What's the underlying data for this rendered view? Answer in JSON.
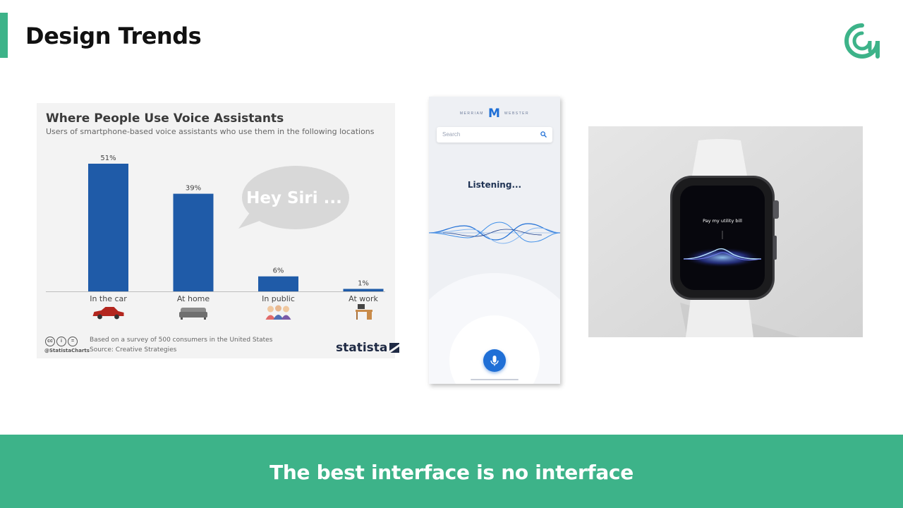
{
  "slide": {
    "title": "Design Trends",
    "tagline": "The best interface is no interface",
    "accent_color": "#3db389"
  },
  "chart_data": {
    "type": "bar",
    "title": "Where People Use Voice Assistants",
    "subtitle": "Users of smartphone-based voice assistants who use them in the following locations",
    "categories": [
      "In the car",
      "At home",
      "In public",
      "At work"
    ],
    "values": [
      51,
      39,
      6,
      1
    ],
    "value_labels": [
      "51%",
      "39%",
      "6%",
      "1%"
    ],
    "category_icons": [
      "car-icon",
      "sofa-icon",
      "people-icon",
      "desk-icon"
    ],
    "ylim": [
      0,
      51
    ],
    "bar_color": "#1f5ba8",
    "grid": false,
    "annotation": "Hey Siri ...",
    "footnote": "Based on a survey of 500 consumers in the United States",
    "source": "Source: Creative Strategies",
    "handle": "@StatistaCharts",
    "brand": "statista"
  },
  "phone": {
    "brand_left": "MERRIAM",
    "brand_mark": "M",
    "brand_right": "WEBSTER",
    "search_placeholder": "Search",
    "status": "Listening...",
    "accent_color": "#1f6fd6"
  },
  "watch": {
    "prompt": "Pay my utility bill"
  }
}
